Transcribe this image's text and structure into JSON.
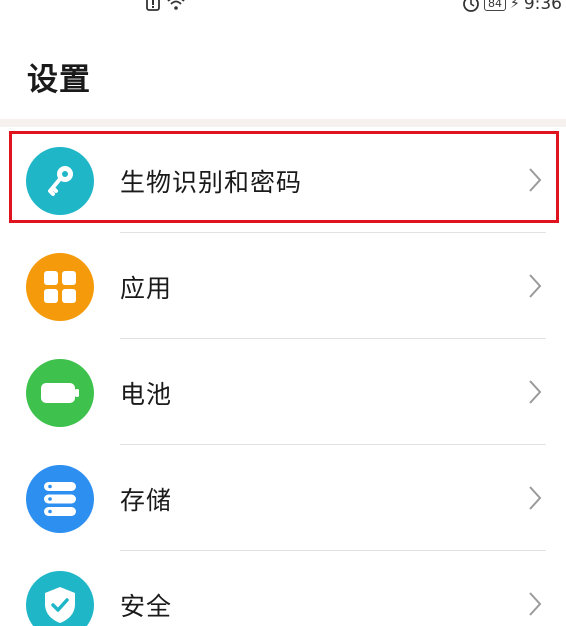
{
  "status_bar": {
    "time": "9:36",
    "battery_level": "84"
  },
  "header": {
    "title": "设置"
  },
  "settings_list": {
    "items": [
      {
        "label": "生物识别和密码",
        "icon": "key-icon",
        "color": "#1fb6c8",
        "highlighted": true
      },
      {
        "label": "应用",
        "icon": "apps-grid-icon",
        "color": "#f59a0a",
        "highlighted": false
      },
      {
        "label": "电池",
        "icon": "battery-icon",
        "color": "#3ec24d",
        "highlighted": false
      },
      {
        "label": "存储",
        "icon": "storage-icon",
        "color": "#2d8ff0",
        "highlighted": false
      },
      {
        "label": "安全",
        "icon": "shield-check-icon",
        "color": "#1fb6c8",
        "highlighted": false
      }
    ]
  },
  "colors": {
    "highlight_border": "#e0141e",
    "header_divider": "#f6f0ee"
  }
}
